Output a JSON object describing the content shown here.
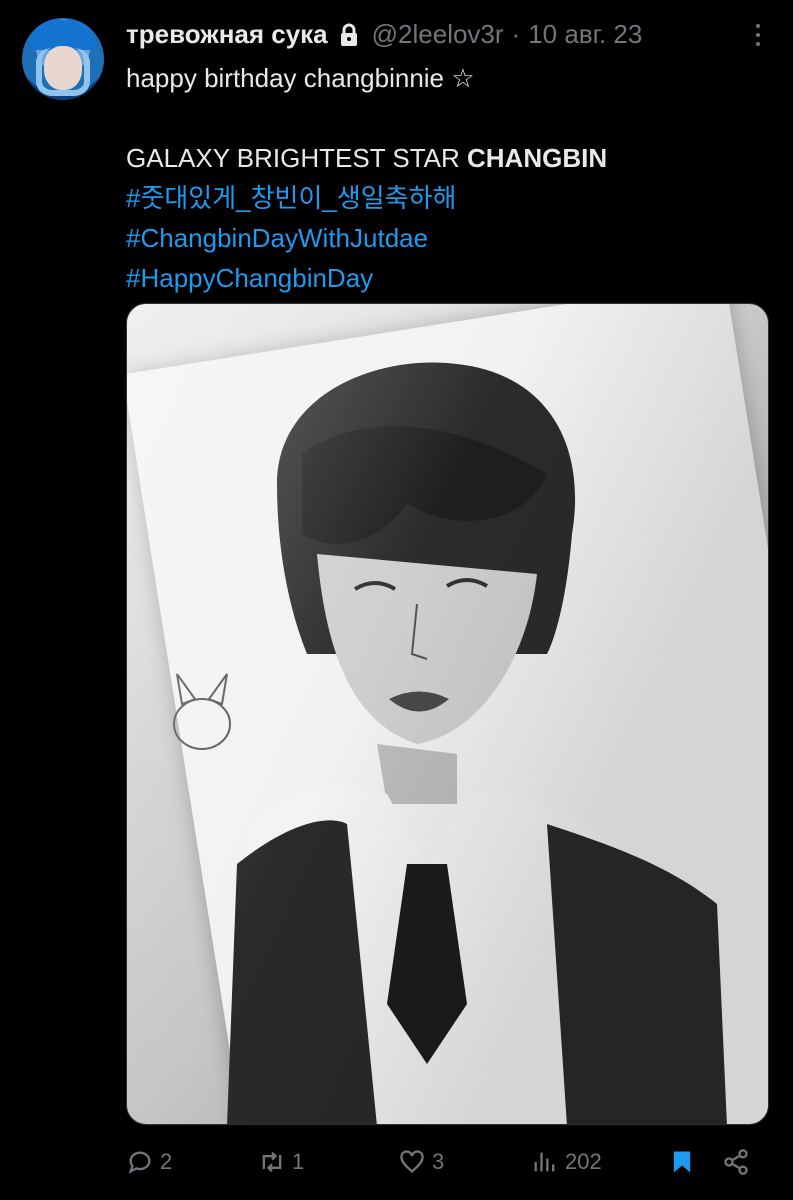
{
  "tweet": {
    "author_name": "тревожная сука",
    "handle": "@2leelov3r",
    "separator": "·",
    "date": "10 авг. 23",
    "lines": [
      "happy birthday changbinnie ☆",
      "",
      "GALAXY BRIGHTEST STAR ",
      "#줏대있게_창빈이_생일축하해",
      "#ChangbinDayWithJutdae",
      "#HappyChangbinDay"
    ],
    "bold_word": "CHANGBIN"
  },
  "actions": {
    "replies": "2",
    "retweets": "1",
    "likes": "3",
    "views": "202"
  },
  "icons": {
    "lock": "lock-icon",
    "more": "more-options-icon",
    "reply": "reply-icon",
    "retweet": "retweet-icon",
    "like": "heart-icon",
    "views": "analytics-icon",
    "bookmark": "bookmark-icon",
    "share": "share-icon"
  },
  "colors": {
    "background": "#000000",
    "text": "#e7e9ea",
    "muted": "#71767b",
    "link": "#1d9bf0"
  }
}
